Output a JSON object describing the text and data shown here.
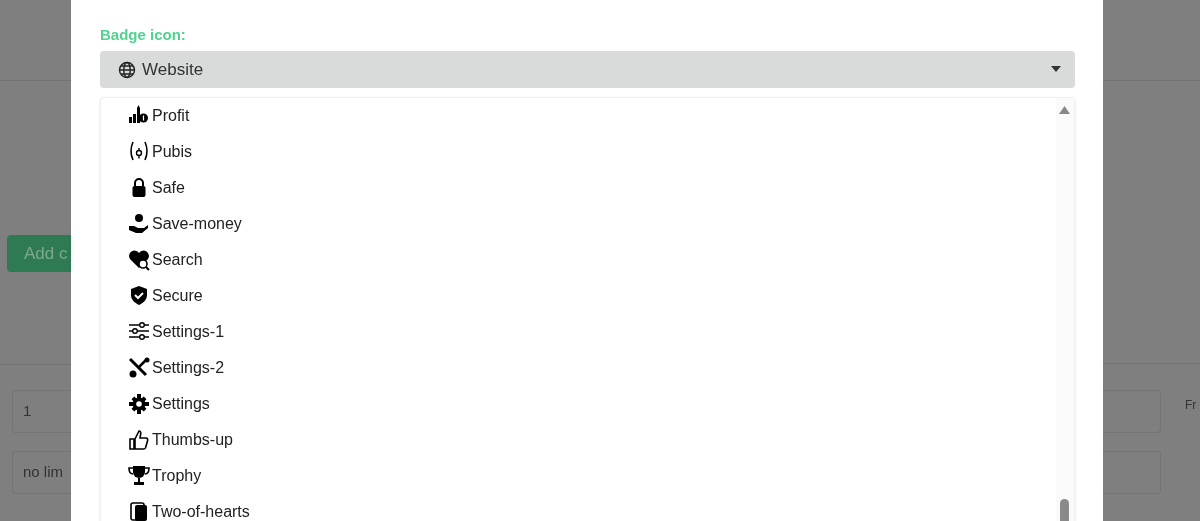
{
  "background": {
    "add_button": "Add c",
    "fields": [
      "1",
      "no lim"
    ],
    "side_text": "Fr"
  },
  "modal": {
    "label": "Badge icon:",
    "select": {
      "value": "Website"
    },
    "options": [
      "Profit",
      "Pubis",
      "Safe",
      "Save-money",
      "Search",
      "Secure",
      "Settings-1",
      "Settings-2",
      "Settings",
      "Thumbs-up",
      "Trophy",
      "Two-of-hearts"
    ]
  }
}
